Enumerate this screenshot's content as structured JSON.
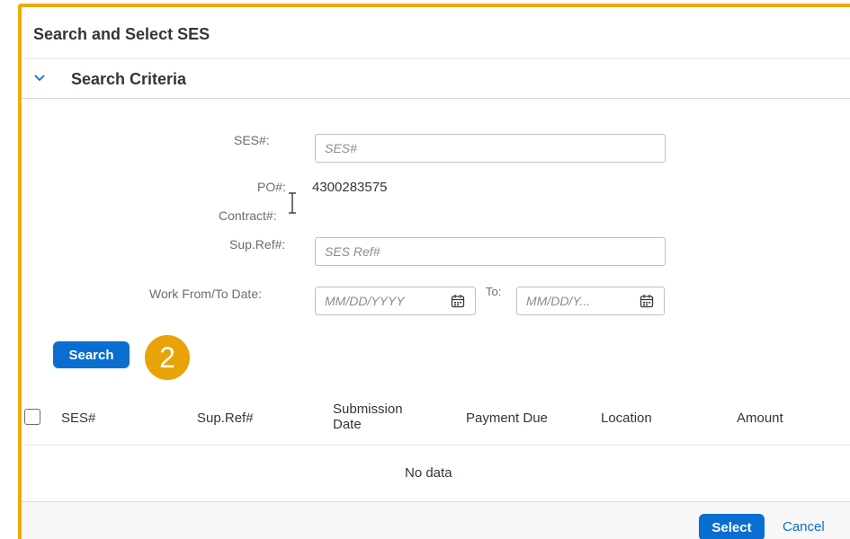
{
  "dialog": {
    "title": "Search and Select SES"
  },
  "search_criteria": {
    "title": "Search Criteria",
    "ses_label": "SES#:",
    "ses_placeholder": "SES#",
    "po_label": "PO#:",
    "po_value": "4300283575",
    "contract_label": "Contract#:",
    "supref_label": "Sup.Ref#:",
    "supref_placeholder": "SES Ref#",
    "date_label": "Work From/To Date:",
    "from_placeholder": "MM/DD/YYYY",
    "to_label": "To:",
    "to_placeholder": "MM/DD/Y..."
  },
  "search_button": "Search",
  "step_badge": "2",
  "table": {
    "columns": [
      "SES#",
      "Sup.Ref#",
      "Submission\nDate",
      "Payment Due",
      "Location",
      "Amount"
    ],
    "empty_text": "No data"
  },
  "footer": {
    "select_label": "Select",
    "cancel_label": "Cancel"
  },
  "colors": {
    "accent": "#0a6ed1",
    "highlight_border": "#f0ab00",
    "badge": "#e8a308"
  },
  "icons": [
    "chevron-down-icon",
    "calendar-icon"
  ]
}
